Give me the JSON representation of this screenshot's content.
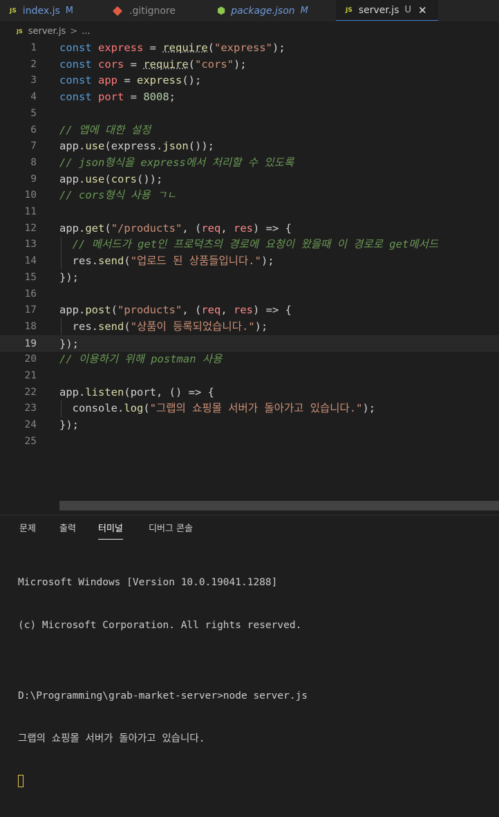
{
  "tabs": [
    {
      "name": "index.js",
      "mark": "M",
      "icon": "js-icon"
    },
    {
      "name": ".gitignore",
      "mark": "",
      "icon": "git-icon"
    },
    {
      "name": "package.json",
      "mark": "M",
      "icon": "node-icon"
    },
    {
      "name": "server.js",
      "mark": "U",
      "icon": "js-icon",
      "active": true
    }
  ],
  "tab_icon_label": "JS",
  "close_glyph": "✕",
  "breadcrumb": {
    "file": "server.js",
    "sep": ">",
    "more": "..."
  },
  "line_numbers": [
    "1",
    "2",
    "3",
    "4",
    "5",
    "6",
    "7",
    "8",
    "9",
    "10",
    "11",
    "12",
    "13",
    "14",
    "15",
    "16",
    "17",
    "18",
    "19",
    "20",
    "21",
    "22",
    "23",
    "24",
    "25"
  ],
  "code_lines": [
    "const express = require(\"express\");",
    "const cors = require(\"cors\");",
    "const app = express();",
    "const port = 8008;",
    "",
    "// 앱에 대한 설정",
    "app.use(express.json());",
    "// json형식을 express에서 처리할 수 있도록",
    "app.use(cors());",
    "// cors형식 사용 ㄱㄴ",
    "",
    "app.get(\"/products\", (req, res) => {",
    "  // 메서드가 get인 프로덕츠의 경로에 요청이 왔을때 이 경로로 get메서드",
    "  res.send(\"업로드 된 상품들입니다.\");",
    "});",
    "",
    "app.post(\"products\", (req, res) => {",
    "  res.send(\"상품이 등록되었습니다.\");",
    "});",
    "// 이용하기 위해 postman 사용",
    "",
    "app.listen(port, () => {",
    "  console.log(\"그랩의 쇼핑몰 서버가 돌아가고 있습니다.\");",
    "});",
    ""
  ],
  "panel_tabs": [
    "문제",
    "출력",
    "터미널",
    "디버그 콘솔"
  ],
  "active_panel_tab": "터미널",
  "terminal_lines": [
    "Microsoft Windows [Version 10.0.19041.1288]",
    "(c) Microsoft Corporation. All rights reserved.",
    "",
    "D:\\Programming\\grab-market-server>node server.js",
    "그랩의 쇼핑몰 서버가 돌아가고 있습니다."
  ],
  "colors": {
    "accent": "#3c7fd0",
    "keyword": "#569cd6",
    "string": "#ce9178",
    "comment": "#6a9955",
    "function": "#dcdcaa"
  }
}
